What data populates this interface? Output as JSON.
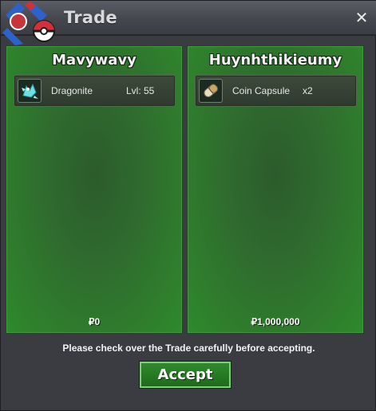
{
  "window": {
    "title": "Trade",
    "close_label": "✕"
  },
  "left_panel": {
    "player": "Mavywavy",
    "item": {
      "name": "Dragonite",
      "level": "Lvl: 55",
      "icon": "dragonite-icon"
    },
    "money": "₽0"
  },
  "right_panel": {
    "player": "Huynhthikieumy",
    "item": {
      "name": "Coin Capsule",
      "quantity": "x2",
      "icon": "coin-capsule-icon"
    },
    "money": "₽1,000,000"
  },
  "footer": {
    "notice": "Please check over the Trade carefully before accepting.",
    "accept_label": "Accept"
  },
  "colors": {
    "panel_green": "#2f7a2d",
    "accept_green": "#2f8a2c",
    "window_bg": "#3a3c42"
  }
}
